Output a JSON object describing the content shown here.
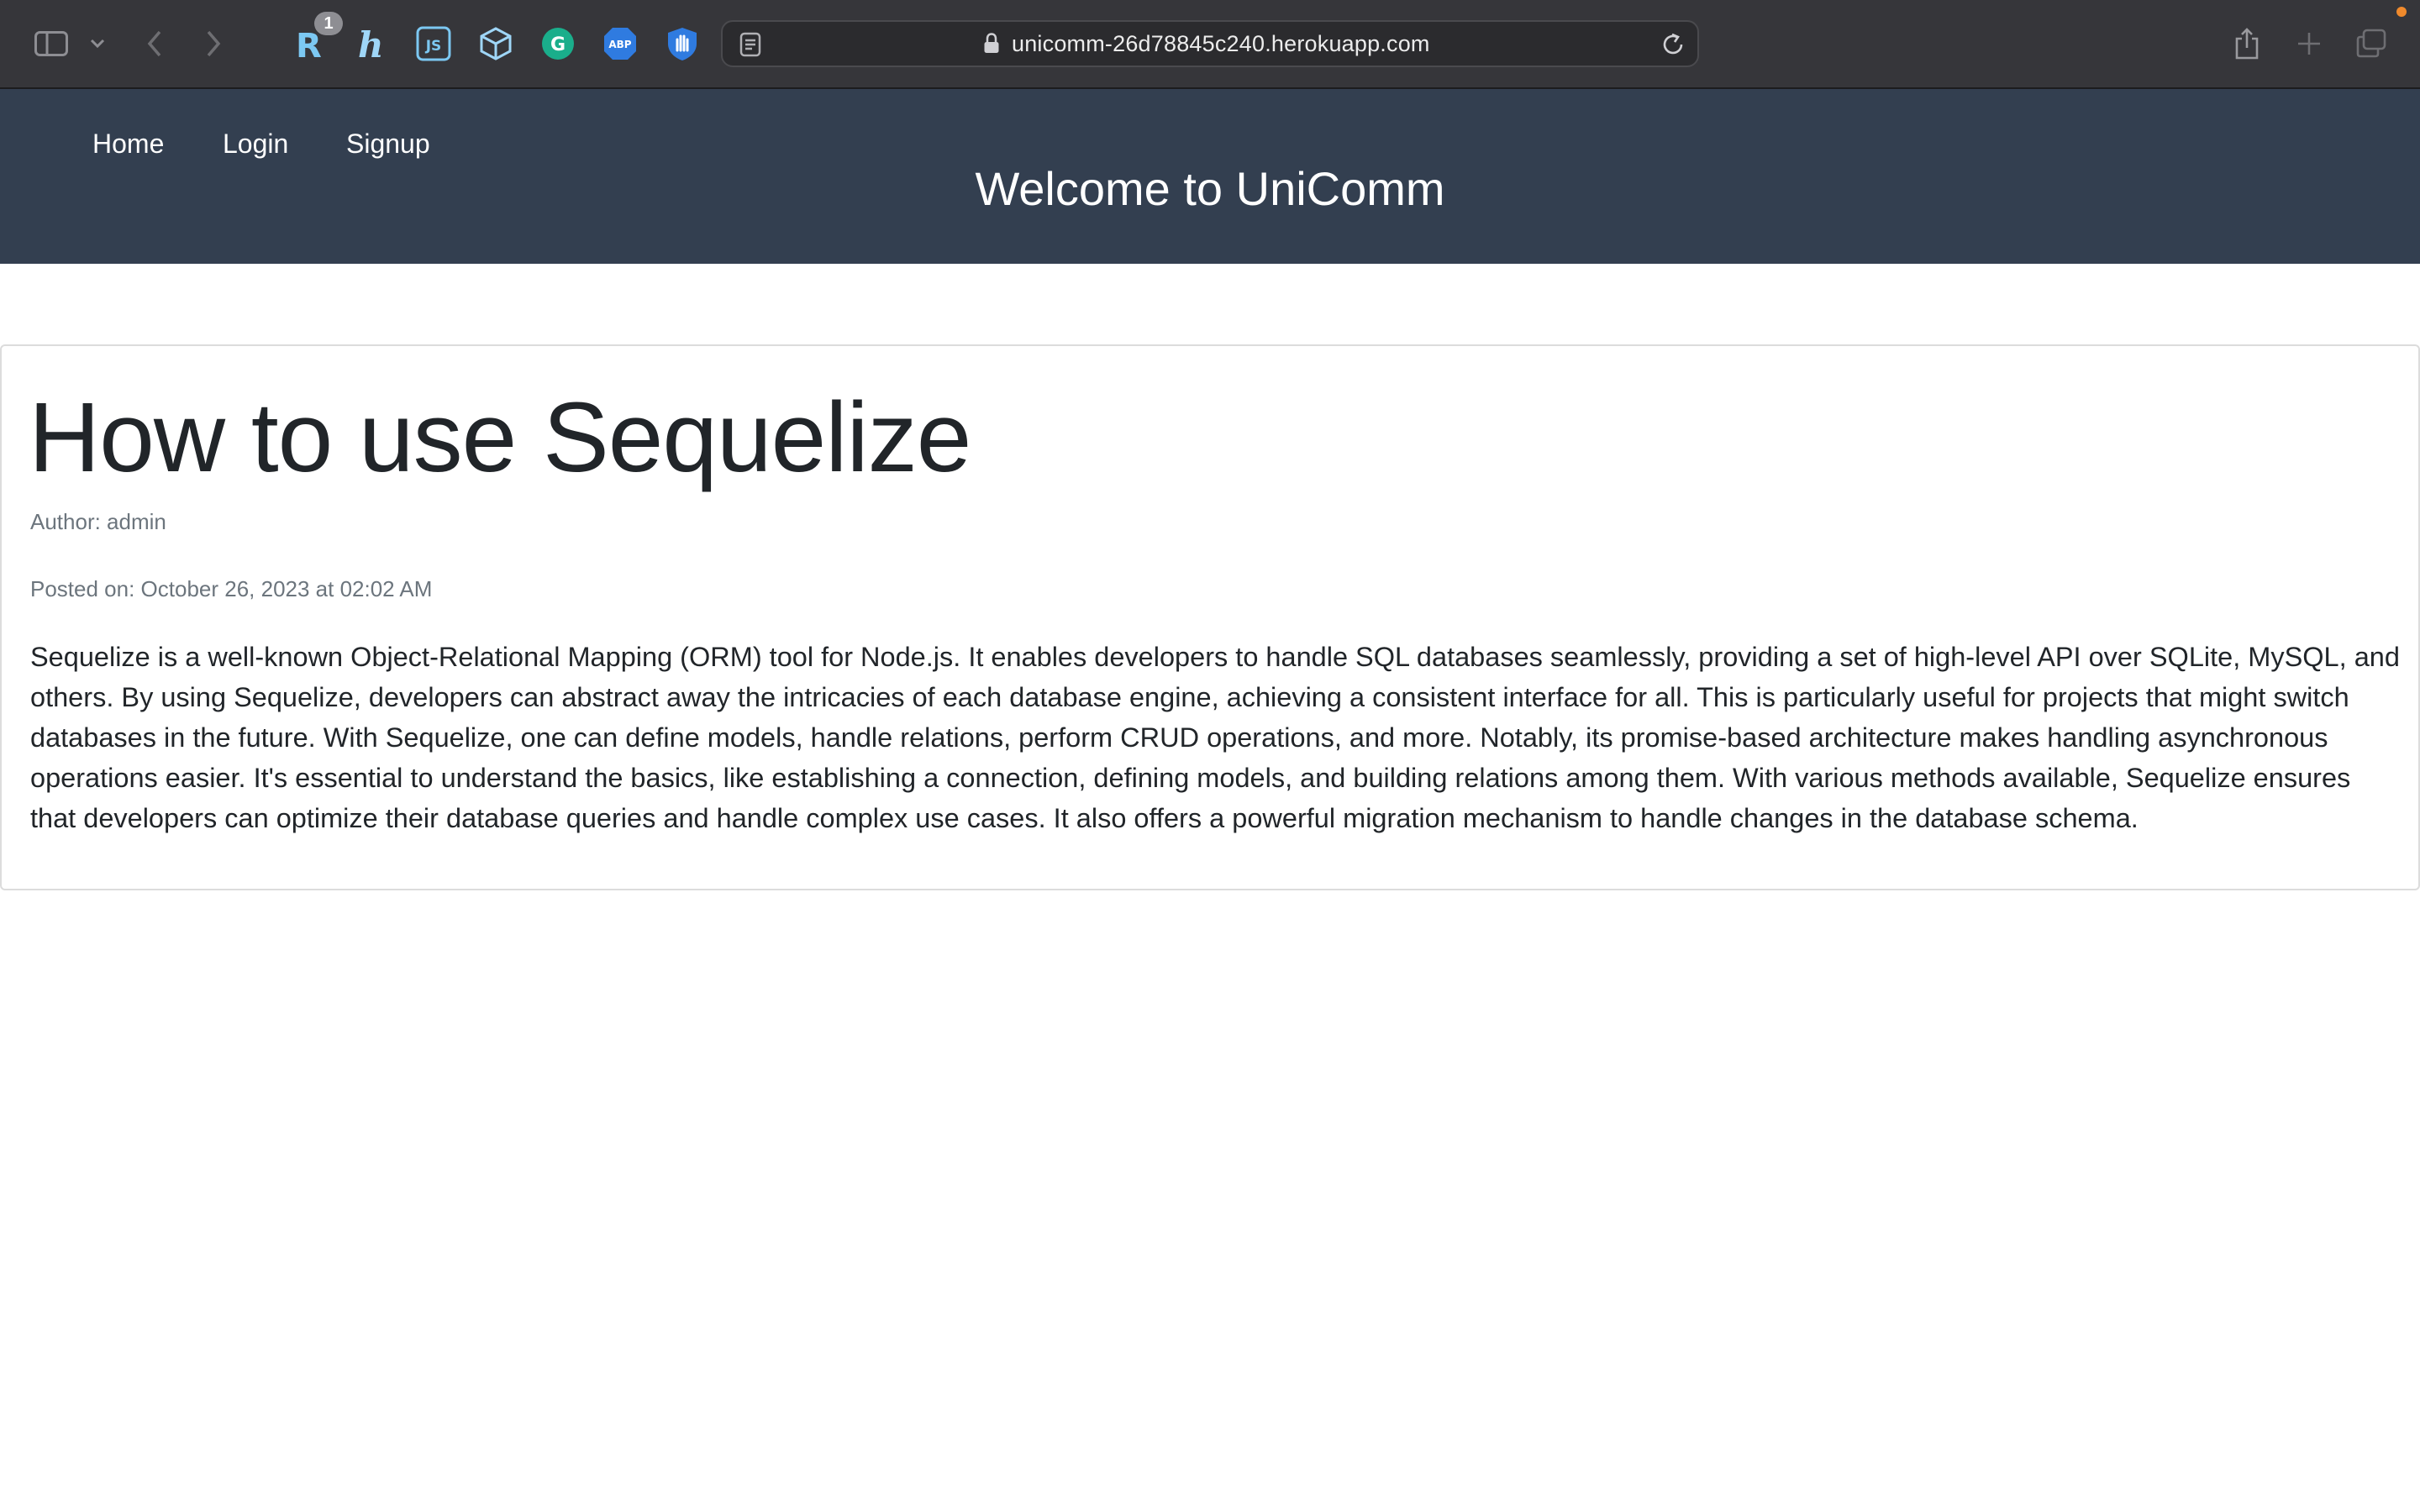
{
  "browser": {
    "url": "unicomm-26d78845c240.herokuapp.com",
    "extensions": [
      {
        "name": "r-extension-icon",
        "label": "R",
        "badge": "1"
      },
      {
        "name": "h-extension-icon",
        "label": "h"
      },
      {
        "name": "js-extension-icon",
        "label": "JS"
      },
      {
        "name": "cube-extension-icon"
      },
      {
        "name": "grammarly-icon",
        "label": "G"
      },
      {
        "name": "adblock-plus-icon",
        "label": "ABP"
      },
      {
        "name": "hand-blocker-icon"
      }
    ],
    "colors": {
      "chrome_bg": "#36363a",
      "accent_dot": "#f08a2c"
    }
  },
  "site": {
    "nav": [
      {
        "label": "Home"
      },
      {
        "label": "Login"
      },
      {
        "label": "Signup"
      }
    ],
    "title": "Welcome to UniComm",
    "header_color": "#333f50"
  },
  "post": {
    "title": "How to use Sequelize",
    "author": "Author: admin",
    "posted": "Posted on: October 26, 2023 at 02:02 AM",
    "body": "Sequelize is a well-known Object-Relational Mapping (ORM) tool for Node.js. It enables developers to handle SQL databases seamlessly, providing a set of high-level API over SQLite, MySQL, and others. By using Sequelize, developers can abstract away the intricacies of each database engine, achieving a consistent interface for all. This is particularly useful for projects that might switch databases in the future. With Sequelize, one can define models, handle relations, perform CRUD operations, and more. Notably, its promise-based architecture makes handling asynchronous operations easier. It's essential to understand the basics, like establishing a connection, defining models, and building relations among them. With various methods available, Sequelize ensures that developers can optimize their database queries and handle complex use cases. It also offers a powerful migration mechanism to handle changes in the database schema."
  }
}
